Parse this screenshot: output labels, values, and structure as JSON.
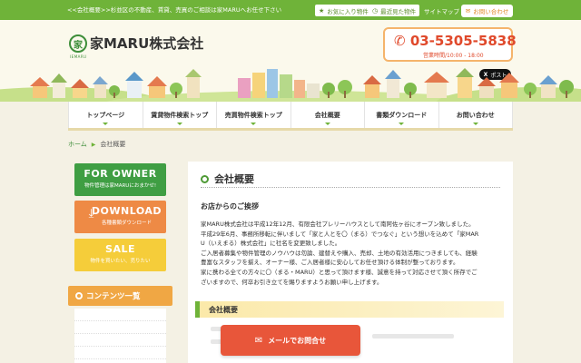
{
  "topbar": {
    "tagline": "<<会社概要>>杉並区の不動産、賃貸、売買のご相談は家MARUへお任せ下さい",
    "favorites": "お気に入り物件",
    "recent": "最近見た物件",
    "sitemap": "サイトマップ",
    "contact": "お問い合わせ"
  },
  "header": {
    "logo_mark": "家",
    "logo_sub": "IEMARU",
    "logo_text": "家MARU株式会社",
    "phone": "03-5305-5838",
    "hours": "営業時間/10:00 - 18:00",
    "x_post": "ポスト"
  },
  "nav": {
    "items": [
      "トップページ",
      "賃貸物件検索トップ",
      "売買物件検索トップ",
      "会社概要",
      "書類ダウンロード",
      "お問い合わせ"
    ]
  },
  "breadcrumb": {
    "home": "ホーム",
    "current": "会社概要"
  },
  "sidebar": {
    "owner_main": "FOR OWNER",
    "owner_sub": "物件管理は家MARUにおまかせ!",
    "download_main": "DOWNLOAD",
    "download_sub": "各種書類ダウンロード",
    "sale_main": "SALE",
    "sale_sub": "物件を買いたい、売りたい",
    "contents_title": "コンテンツ一覧"
  },
  "main": {
    "title": "会社概要",
    "greeting_title": "お店からのご挨拶",
    "paragraphs": [
      "家MARU株式会社は平成12年12月、有限会社プレリーハウスとして南阿佐ヶ谷にオープン致しました。",
      "平成29年6月、事務所移転に伴いまして「家と人とを〇（まる）でつなぐ」という想いを込めて「家MAR",
      "U（いえまる）株式会社」に社名を変更致しました。",
      "ご入居者募集や物件管理のノウハウは勿論、建替えや購入、売却、土地の有効活用につきましても、経験",
      "豊富なスタッフを揃え、オーナー様、ご入居者様に安心してお任せ頂ける体制が整っております。",
      "家に携わる全ての方々に〇（まる・MARU）と思って頂けます様、誠意を持って対応させて頂く所存でご",
      "ざいますので、何卒お引き立てを賜りますようお願い申し上げます。"
    ],
    "section_title": "会社概要",
    "mail_button": "メールでお問合せ"
  },
  "colors": {
    "brand_green": "#6fb339",
    "phone_red": "#e0492b",
    "mail_button": "#e8563a",
    "owner_green": "#3f9e43",
    "download_orange": "#ee8a45",
    "sale_yellow": "#f5cd3a"
  }
}
